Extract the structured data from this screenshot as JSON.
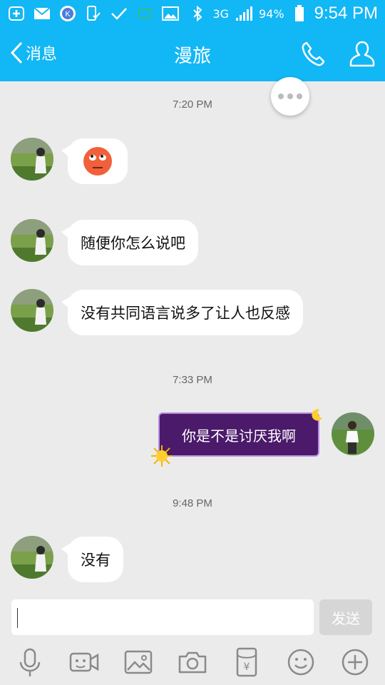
{
  "status_bar": {
    "left_icons": [
      "plus-box-icon",
      "mail-icon",
      "k-app-icon",
      "phone-check-icon",
      "check-icon",
      "square-icon",
      "image-icon"
    ],
    "battery": "94%",
    "network": "3G",
    "time": "9:54 PM"
  },
  "header": {
    "back_label": "消息",
    "title": "漫旅"
  },
  "messages": {
    "ts1": "7:20 PM",
    "m1_emoji": "rolling-eyes-emoji",
    "m2": "随便你怎么说吧",
    "m3": "没有共同语言说多了让人也反感",
    "ts2": "7:33 PM",
    "m4": "你是不是讨厌我啊",
    "ts3": "9:48 PM",
    "m5": "没有"
  },
  "composer": {
    "input_value": "",
    "send_label": "发送"
  },
  "toolbar_icons": [
    "microphone-icon",
    "video-chat-icon",
    "image-icon",
    "camera-icon",
    "red-packet-icon",
    "emoji-icon",
    "plus-icon"
  ],
  "colors": {
    "accent": "#12b7f5",
    "chat_bg": "#ebebeb",
    "special_bubble": "#4b1a6a"
  }
}
